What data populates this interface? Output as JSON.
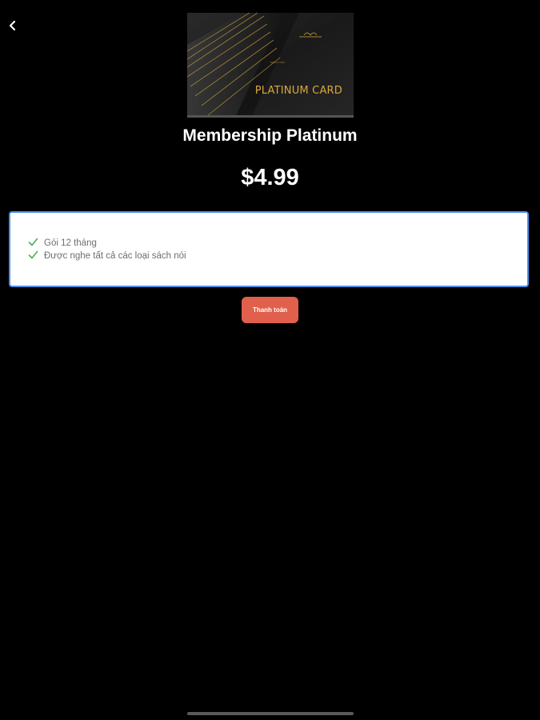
{
  "header": {
    "back_icon": "chevron-left-icon"
  },
  "card": {
    "brand_text": "SÁCH NÓI",
    "label": "PLATINUM CARD",
    "accent_color": "#d8a73e"
  },
  "plan": {
    "title": "Membership Platinum",
    "price": "$4.99"
  },
  "features": [
    {
      "icon": "check-icon",
      "text": "Gói 12 tháng"
    },
    {
      "icon": "check-icon",
      "text": "Được nghe tất cả các loại sách nói"
    }
  ],
  "actions": {
    "pay_label": "Thanh toán",
    "pay_color": "#e0604c"
  },
  "colors": {
    "background": "#000000",
    "check": "#4caf50",
    "box_border": "#4a8df0"
  }
}
